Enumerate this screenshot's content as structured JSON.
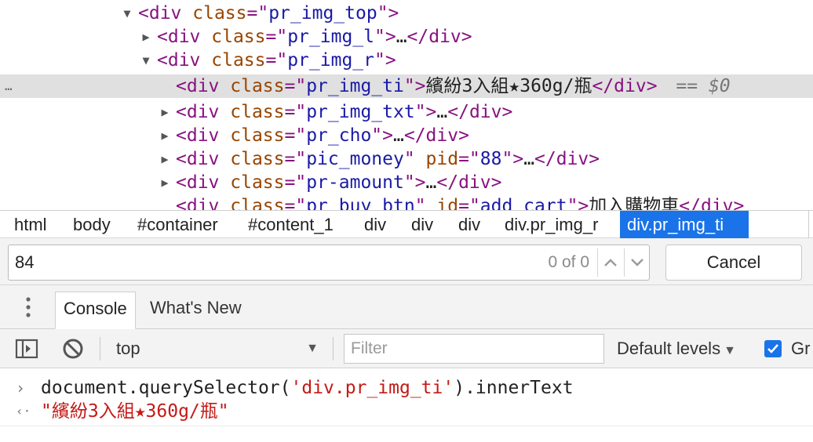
{
  "tree": {
    "line0": {
      "open": "<div ",
      "attr": "class",
      "eq": "=\"",
      "val": "pr_img_top",
      "close": "\">"
    },
    "line1": {
      "open": "<div ",
      "attr": "class",
      "eq": "=\"",
      "val": "pr_img_l",
      "close": "\">",
      "ellipsis": "…",
      "end": "</div>"
    },
    "line2": {
      "open": "<div ",
      "attr": "class",
      "eq": "=\"",
      "val": "pr_img_r",
      "close": "\">"
    },
    "line3": {
      "open": "<div ",
      "attr": "class",
      "eq": "=\"",
      "val": "pr_img_ti",
      "close": "\">",
      "text": "繽紛3入組★360g/瓶",
      "end": "</div>",
      "marker": "== $0"
    },
    "line4": {
      "open": "<div ",
      "attr": "class",
      "eq": "=\"",
      "val": "pr_img_txt",
      "close": "\">",
      "ellipsis": "…",
      "end": "</div>"
    },
    "line5": {
      "open": "<div ",
      "attr": "class",
      "eq": "=\"",
      "val": "pr_cho",
      "close": "\">",
      "ellipsis": "…",
      "end": "</div>"
    },
    "line6": {
      "open": "<div ",
      "attr": "class",
      "eq": "=\"",
      "val": "pic_money",
      "close": "\"",
      "attr2": " pid",
      "eq2": "=\"",
      "val2": "88",
      "close2": "\">",
      "ellipsis": "…",
      "end": "</div>"
    },
    "line7": {
      "open": "<div ",
      "attr": "class",
      "eq": "=\"",
      "val": "pr-amount",
      "close": "\">",
      "ellipsis": "…",
      "end": "</div>"
    },
    "line8": {
      "open": "<div ",
      "attr": "class",
      "eq": "=\"",
      "val": "pr_buy_btn",
      "close": "\"",
      "attr2": " id",
      "eq2": "=\"",
      "val2": "add_cart",
      "close2": "\">",
      "text": "加入購物車",
      "end": "</div>"
    },
    "row_menu": "…"
  },
  "breadcrumb": [
    "html",
    "body",
    "#container",
    "#content_1",
    "div",
    "div",
    "div",
    "div.pr_img_r",
    "div.pr_img_ti"
  ],
  "search": {
    "value": "84",
    "match_count": "0 of 0",
    "cancel_label": "Cancel"
  },
  "drawer": {
    "tabs": [
      "Console",
      "What's New"
    ],
    "active_tab": "Console"
  },
  "toolbar": {
    "context": "top",
    "filter_placeholder": "Filter",
    "levels": "Default levels",
    "group_label": "Gr"
  },
  "console": {
    "input_prefix": "document.querySelector(",
    "input_string": "'div.pr_img_ti'",
    "input_suffix": ").innerText",
    "result": "\"繽紛3入組★360g/瓶\"",
    "input_prompt": "›",
    "result_prompt": "‹·"
  },
  "colors": {
    "tag": "#881280",
    "attr_name": "#994500",
    "attr_value": "#1a1aa6",
    "string": "#c41a16",
    "accent": "#1a73e8"
  }
}
